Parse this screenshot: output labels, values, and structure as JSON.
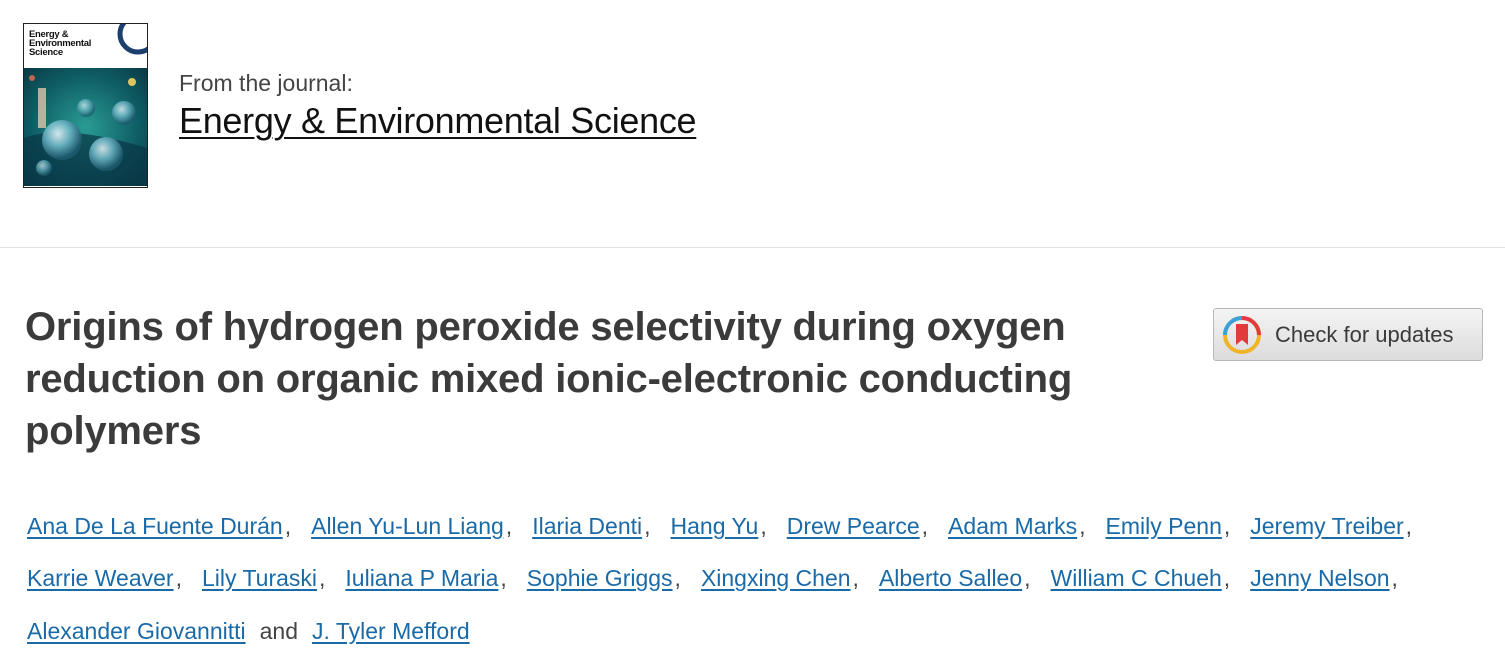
{
  "journal": {
    "from_label": "From the journal:",
    "name": "Energy & Environmental Science",
    "cover": {
      "title_lines": [
        "Energy &",
        "Environmental",
        "Science"
      ],
      "accent_colors": [
        "#0b6b6b",
        "#1c8f8a",
        "#3fa9d6",
        "#cfe8ef",
        "#1d3f6e"
      ]
    }
  },
  "article": {
    "title": "Origins of hydrogen peroxide selectivity during oxygen reduction on organic mixed ionic-electronic conducting polymers"
  },
  "check_updates": {
    "label": "Check for updates",
    "icon": "crossmark-icon"
  },
  "authors": {
    "separator": ",",
    "conjunction": "and",
    "link_color": "#1a6aa8",
    "lines": [
      [
        "Ana De La Fuente Durán",
        "Allen Yu-Lun Liang",
        "Ilaria Denti",
        "Hang Yu",
        "Drew Pearce",
        "Adam Marks",
        "Emily Penn",
        "Jeremy Treiber"
      ],
      [
        "Karrie Weaver",
        "Lily Turaski",
        "Iuliana P Maria",
        "Sophie Griggs",
        "Xingxing Chen",
        "Alberto Salleo",
        "William C Chueh",
        "Jenny Nelson"
      ],
      [
        "Alexander Giovannitti",
        "J. Tyler Mefford"
      ]
    ]
  }
}
